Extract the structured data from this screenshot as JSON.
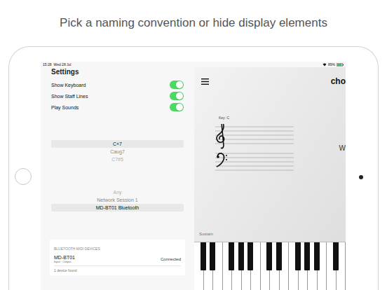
{
  "caption": "Pick a naming convention or hide display elements",
  "status_bar": {
    "time": "15:28",
    "date": "Wed 28 Jul",
    "battery": "89%"
  },
  "settings": {
    "title": "Settings",
    "toggles": [
      {
        "label": "Show Keyboard",
        "on": true
      },
      {
        "label": "Show Staff Lines",
        "on": true
      },
      {
        "label": "Play Sounds",
        "on": true
      }
    ],
    "chord_names": [
      {
        "label": "C+7",
        "selected": true
      },
      {
        "label": "Caug7",
        "selected": false
      },
      {
        "label": "C7#5",
        "selected": false
      }
    ],
    "midi_sources": [
      {
        "label": "Any",
        "selected": false
      },
      {
        "label": "Network Session 1",
        "selected": false
      },
      {
        "label": "MD-BT01 Bluetooth",
        "selected": true
      }
    ],
    "bluetooth": {
      "header": "BLUETOOTH MIDI DEVICES",
      "devices": [
        {
          "name": "MD-BT01",
          "ports": "Input · Output",
          "status": "Connected"
        }
      ],
      "footer": "1 device found"
    }
  },
  "main": {
    "title": "cho",
    "key": "Key: C",
    "side_text": "W",
    "sustain": "Sustain"
  }
}
